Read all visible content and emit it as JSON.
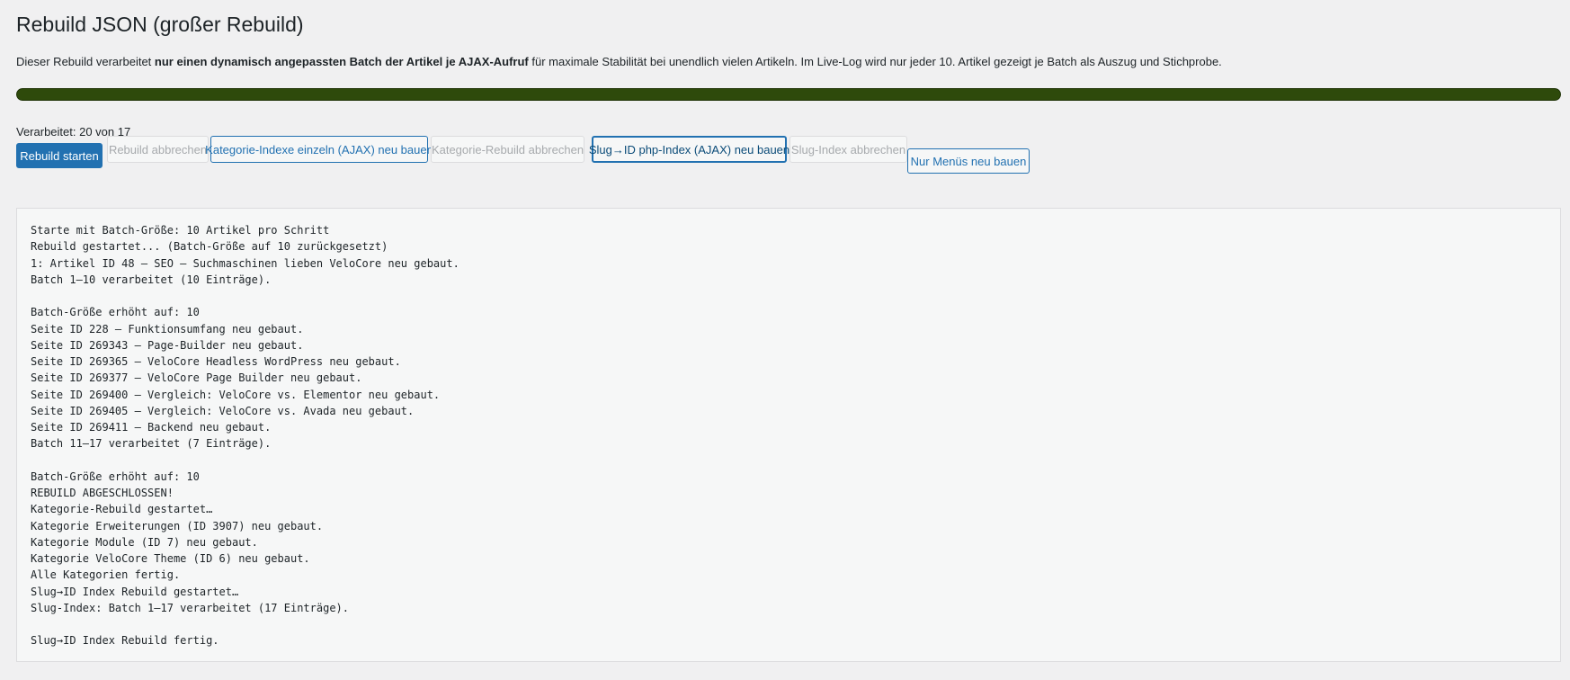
{
  "page": {
    "title": "Rebuild JSON (großer Rebuild)"
  },
  "description": {
    "part1": "Dieser Rebuild verarbeitet ",
    "bold1": "nur einen dynamisch angepassten Batch der Artikel je AJAX-Aufruf",
    "part2": " für maximale Stabilität bei unendlich vielen Artikeln. Im Live-Log wird nur jeder 10. Artikel gezeigt je Batch als Auszug und Stichprobe."
  },
  "progress": {
    "fraction": 1.0,
    "color": "#2e4a0b"
  },
  "status": {
    "processed_text": "Verarbeitet: 20 von 17"
  },
  "buttons": {
    "rebuild_start": "Rebuild starten",
    "rebuild_cancel": "Rebuild abbrechen",
    "category_rebuild": "Kategorie-Indexe einzeln (AJAX) neu bauen",
    "category_cancel": "Kategorie-Rebuild abbrechen",
    "slug_rebuild": "Slug→ID php-Index (AJAX) neu bauen",
    "slug_cancel": "Slug-Index abbrechen",
    "menus_rebuild": "Nur Menüs neu bauen"
  },
  "log": {
    "lines": [
      "Starte mit Batch-Größe: 10 Artikel pro Schritt",
      "Rebuild gestartet... (Batch-Größe auf 10 zurückgesetzt)",
      "1: Artikel ID 48 – SEO – Suchmaschinen lieben VeloCore neu gebaut.",
      "Batch 1–10 verarbeitet (10 Einträge).",
      "",
      "Batch-Größe erhöht auf: 10",
      "Seite ID 228 – Funktionsumfang neu gebaut.",
      "Seite ID 269343 – Page-Builder neu gebaut.",
      "Seite ID 269365 – VeloCore Headless WordPress neu gebaut.",
      "Seite ID 269377 – VeloCore Page Builder neu gebaut.",
      "Seite ID 269400 – Vergleich: VeloCore vs. Elementor neu gebaut.",
      "Seite ID 269405 – Vergleich: VeloCore vs. Avada neu gebaut.",
      "Seite ID 269411 – Backend neu gebaut.",
      "Batch 11–17 verarbeitet (7 Einträge).",
      "",
      "Batch-Größe erhöht auf: 10",
      "REBUILD ABGESCHLOSSEN!",
      "Kategorie-Rebuild gestartet…",
      "Kategorie Erweiterungen (ID 3907) neu gebaut.",
      "Kategorie Module (ID 7) neu gebaut.",
      "Kategorie VeloCore Theme (ID 6) neu gebaut.",
      "Alle Kategorien fertig.",
      "Slug→ID Index Rebuild gestartet…",
      "Slug-Index: Batch 1–17 verarbeitet (17 Einträge).",
      "",
      "Slug→ID Index Rebuild fertig."
    ]
  },
  "colors": {
    "primary": "#2271b1",
    "background": "#f0f0f1"
  }
}
